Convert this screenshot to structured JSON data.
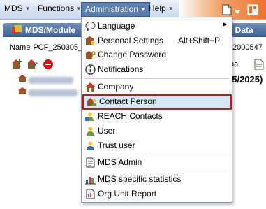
{
  "menubar": {
    "items": [
      {
        "label": "MDS"
      },
      {
        "label": "Functions"
      },
      {
        "label": "Administration"
      },
      {
        "label": "Help"
      }
    ]
  },
  "window": {
    "title": "MDS/Module",
    "title_right": "er Data",
    "name_label": "Name",
    "name_value": "PCF_250305_",
    "id_right": "2000547",
    "toolbar_partial": "nal",
    "date_partial": "05/2025)"
  },
  "dropdown": {
    "items": [
      {
        "label": "Language",
        "icon": "speech-bubble-icon",
        "submenu": true
      },
      {
        "label": "Personal Settings",
        "icon": "person-settings-icon",
        "shortcut": "Alt+Shift+P"
      },
      {
        "label": "Change Password",
        "icon": "key-icon"
      },
      {
        "label": "Notifications",
        "icon": "info-icon"
      },
      {
        "label": "Company",
        "icon": "company-building-icon"
      },
      {
        "label": "Contact Person",
        "icon": "contact-person-icon"
      },
      {
        "label": "REACH Contacts",
        "icon": "reach-contacts-icon"
      },
      {
        "label": "User",
        "icon": "user-icon"
      },
      {
        "label": "Trust user",
        "icon": "trust-user-icon"
      },
      {
        "label": "MDS Admin",
        "icon": "admin-document-icon"
      },
      {
        "label": "MDS specific statistics",
        "icon": "statistics-chart-icon"
      },
      {
        "label": "Org Unit Report",
        "icon": "org-report-icon"
      }
    ]
  },
  "colors": {
    "menubar_active": "#5a7fb0",
    "highlight_border": "#d9101a",
    "highlight_bg": "#d9e6f5",
    "titlebar": "#3f6596",
    "accent_orange": "#e9722d"
  }
}
